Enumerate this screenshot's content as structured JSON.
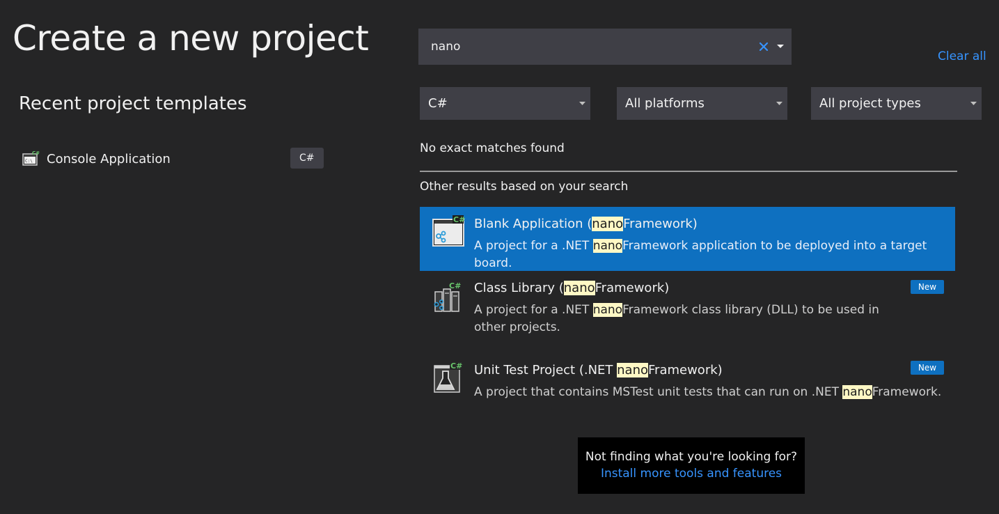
{
  "page": {
    "title": "Create a new project"
  },
  "recent": {
    "heading": "Recent project templates",
    "items": [
      {
        "label": "Console Application",
        "language": "C#",
        "icon": "console-app-icon"
      }
    ]
  },
  "search": {
    "value": "nano",
    "clear_icon": "close-icon",
    "dropdown_icon": "caret-down-icon",
    "clear_all_label": "Clear all"
  },
  "filters": {
    "language": "C#",
    "platform": "All platforms",
    "project_type": "All project types"
  },
  "results": {
    "no_match_text": "No exact matches found",
    "other_results_heading": "Other results based on your search",
    "highlight_term": "nano",
    "templates": [
      {
        "title_pre": "Blank Application (",
        "title_hl": "nano",
        "title_post": "Framework)",
        "desc_pre": "A project for a .NET ",
        "desc_hl": "nano",
        "desc_post": "Framework application to be deployed into a target board.",
        "selected": true,
        "badge": "",
        "icon": "blank-app-icon"
      },
      {
        "title_pre": "Class Library (",
        "title_hl": "nano",
        "title_post": "Framework)",
        "desc_pre": "A project for a .NET ",
        "desc_hl": "nano",
        "desc_post": "Framework class library (DLL) to be used in other projects.",
        "selected": false,
        "badge": "New",
        "icon": "class-library-icon"
      },
      {
        "title_pre": "Unit Test Project (.NET ",
        "title_hl": "nano",
        "title_post": "Framework)",
        "desc_pre": "A project that contains MSTest unit tests that can run on .NET ",
        "desc_hl": "nano",
        "desc_post": "Framework.",
        "selected": false,
        "badge": "New",
        "icon": "unit-test-icon"
      }
    ]
  },
  "footer": {
    "question": "Not finding what you're looking for?",
    "link": "Install more tools and features"
  },
  "colors": {
    "background": "#252526",
    "control": "#3f3f46",
    "accent": "#0e70c0",
    "link": "#3794ff",
    "highlight": "#fff8c5",
    "csharp_green": "#68c46b"
  }
}
